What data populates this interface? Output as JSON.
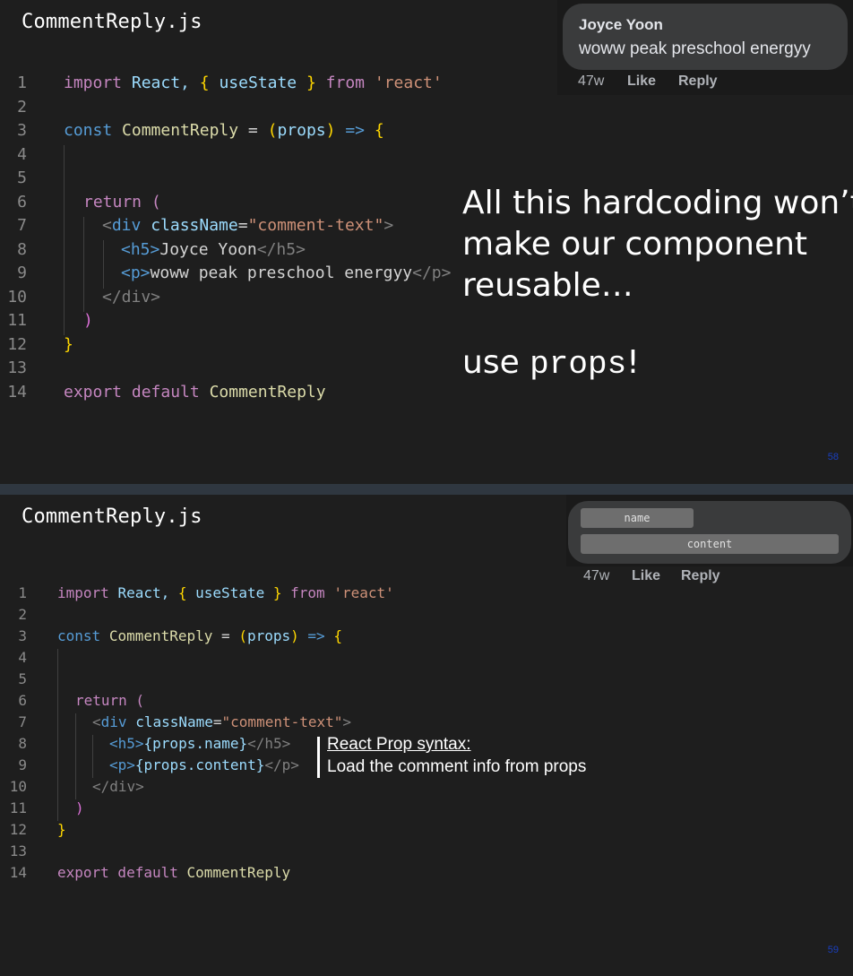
{
  "slide1": {
    "file_title": "CommentReply.js",
    "line_numbers": [
      "1",
      "2",
      "3",
      "4",
      "5",
      "6",
      "7",
      "8",
      "9",
      "10",
      "11",
      "12",
      "13",
      "14"
    ],
    "code": {
      "l1_import": "import",
      "l1_react": "React,",
      "l1_brace_open": "{",
      "l1_usestate": "useState",
      "l1_brace_close": "}",
      "l1_from": "from",
      "l1_str": "'react'",
      "l3_const": "const",
      "l3_name": "CommentReply",
      "l3_eq": "=",
      "l3_paren_open": "(",
      "l3_props": "props",
      "l3_paren_close": ")",
      "l3_arrow": "=>",
      "l3_brace": "{",
      "l6_return": "return (",
      "l7_open": "<",
      "l7_tag": "div",
      "l7_attr": "className",
      "l7_eq": "=",
      "l7_val": "\"comment-text\"",
      "l7_close": ">",
      "l8_open": "<h5>",
      "l8_text": "Joyce Yoon",
      "l8_close": "</h5>",
      "l9_open": "<p>",
      "l9_text": "woww peak preschool energyy",
      "l9_close": "</p>",
      "l10_close": "</div>",
      "l11_paren": ")",
      "l12_brace": "}",
      "l14_export": "export default",
      "l14_name": "CommentReply"
    },
    "comment_card": {
      "name": "Joyce Yoon",
      "text": "woww peak preschool energyy",
      "age": "47w",
      "like": "Like",
      "reply": "Reply"
    },
    "annotation_lines": [
      "All this hardcoding won’t",
      "make our component",
      "reusable…"
    ],
    "annotation_use": "use ",
    "annotation_props": "props",
    "annotation_bang": "!",
    "page_number": "58"
  },
  "slide2": {
    "file_title": "CommentReply.js",
    "line_numbers": [
      "1",
      "2",
      "3",
      "4",
      "5",
      "6",
      "7",
      "8",
      "9",
      "10",
      "11",
      "12",
      "13",
      "14"
    ],
    "code": {
      "l1_import": "import",
      "l1_react": "React,",
      "l1_brace_open": "{",
      "l1_usestate": "useState",
      "l1_brace_close": "}",
      "l1_from": "from",
      "l1_str": "'react'",
      "l3_const": "const",
      "l3_name": "CommentReply",
      "l3_eq": "=",
      "l3_paren_open": "(",
      "l3_props": "props",
      "l3_paren_close": ")",
      "l3_arrow": "=>",
      "l3_brace": "{",
      "l6_return": "return (",
      "l7_open": "<",
      "l7_tag": "div",
      "l7_attr": "className",
      "l7_eq": "=",
      "l7_val": "\"comment-text\"",
      "l7_close": ">",
      "l8_open": "<h5>",
      "l8_expr": "{props.name}",
      "l8_close": "</h5>",
      "l9_open": "<p>",
      "l9_expr": "{props.content}",
      "l9_close": "</p>",
      "l10_close": "</div>",
      "l11_paren": ")",
      "l12_brace": "}",
      "l14_export": "export default",
      "l14_name": "CommentReply"
    },
    "comment_card": {
      "name_placeholder": "name",
      "content_placeholder": "content",
      "age": "47w",
      "like": "Like",
      "reply": "Reply"
    },
    "annotation_title": "React Prop syntax:",
    "annotation_text": "Load the comment info from props",
    "page_number": "59"
  }
}
